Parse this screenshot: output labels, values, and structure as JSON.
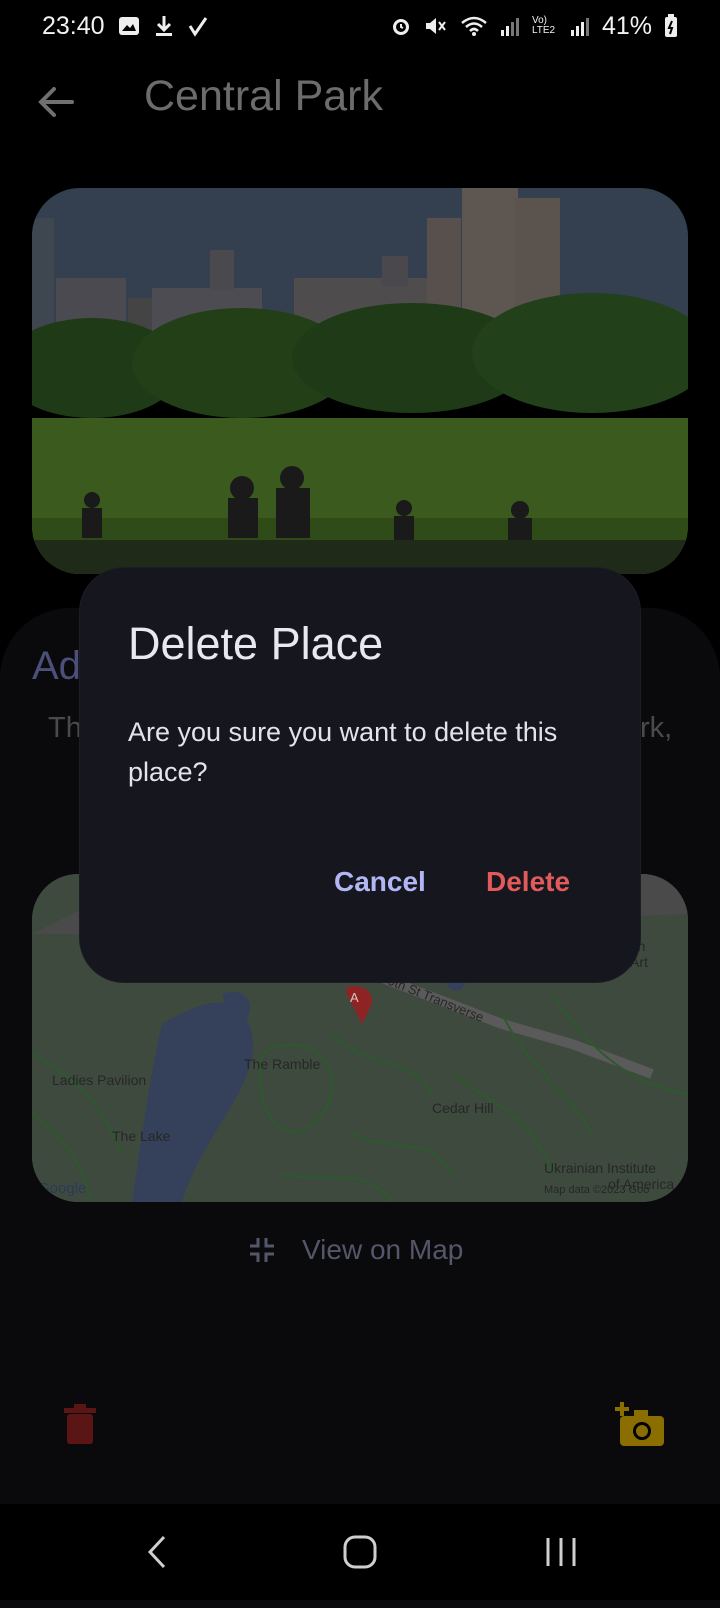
{
  "status_bar": {
    "time": "23:40",
    "battery": "41%",
    "left_icons": [
      "image-icon",
      "download-icon",
      "check-icon"
    ],
    "right_icons": [
      "alarm-icon",
      "mute-icon",
      "wifi-icon",
      "signal-icon",
      "volte-icon",
      "signal-icon",
      "battery-icon"
    ],
    "volte_label": "Vo) LTE2"
  },
  "header": {
    "title": "Central Park"
  },
  "details": {
    "title_fragment": "Ad",
    "text_fragment_left": "Th",
    "text_fragment_right": "rk,"
  },
  "map": {
    "labels": {
      "ladies_pavilion": "Ladies Pavilion",
      "the_ramble": "The Ramble",
      "transverse": "79th St Transverse",
      "cedar_hill": "Cedar Hill",
      "the_lake": "The Lake",
      "ukrainian_1": "Ukrainian Institute",
      "ukrainian_2": "of America",
      "museum_1": "tan",
      "museum_2": "Art",
      "google": "Google",
      "map_data": "Map data ©2023 Goo",
      "marker": "A"
    }
  },
  "view_on_map": {
    "label": "View on Map"
  },
  "dialog": {
    "title": "Delete Place",
    "message": "Are you sure you want to delete this place?",
    "cancel_label": "Cancel",
    "delete_label": "Delete"
  },
  "colors": {
    "accent": "#b2b6f4",
    "danger": "#e35a5a",
    "dialog_bg": "#16161e",
    "warning": "#8a6e00"
  }
}
